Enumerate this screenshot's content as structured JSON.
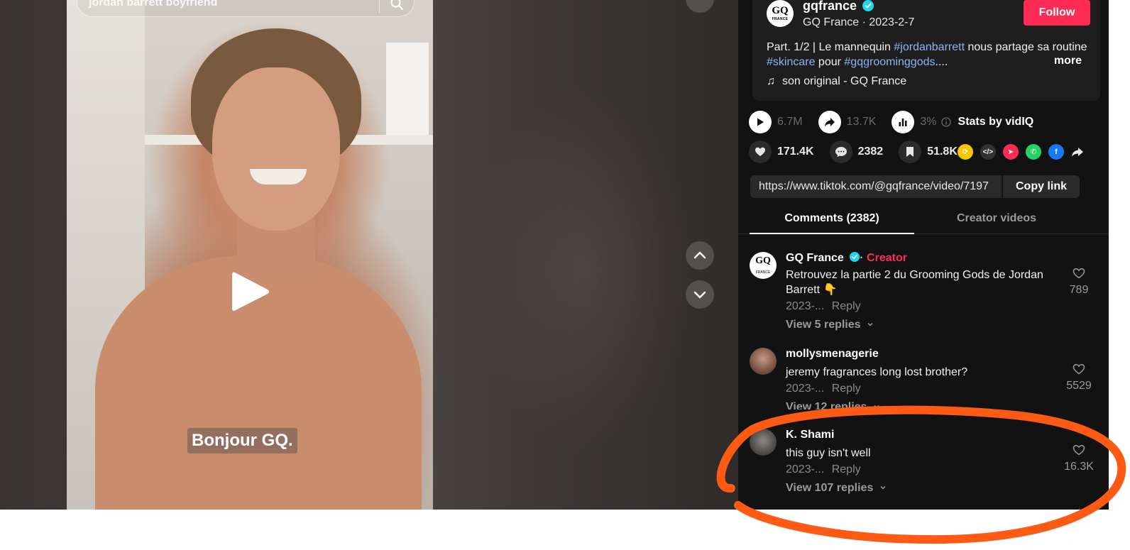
{
  "search": {
    "query": "jordan barrett boyfriend"
  },
  "video": {
    "caption": "Bonjour GQ.",
    "colors": {
      "panel_bg": "#121212",
      "accent": "#fe2c55",
      "hashtag": "#8ab4f8",
      "annotation": "#ff5a14"
    }
  },
  "author": {
    "avatar_text": "GQ",
    "avatar_subtext": "FRANCE",
    "handle": "gqfrance",
    "subline": "GQ France · 2023-2-7",
    "follow_label": "Follow",
    "verified_icon": "verified-badge-icon"
  },
  "description": {
    "part1": "Part. 1/2 | Le mannequin ",
    "tag1": "#jordanbarrett",
    "part2": " nous partage sa routine ",
    "tag2": "#skincare",
    "part3": " pour ",
    "tag3": "#gqgroominggods",
    "part4": "....",
    "more_label": "more",
    "music": "son original - GQ France"
  },
  "stats": {
    "plays": "6.7M",
    "shares": "13.7K",
    "engagement": "3%",
    "vidiq_label": "Stats by vidIQ",
    "likes": "171.4K",
    "comments": "2382",
    "saves": "51.8K"
  },
  "link": {
    "url": "https://www.tiktok.com/@gqfrance/video/7197",
    "copy_label": "Copy link"
  },
  "tabs": {
    "comments": "Comments (2382)",
    "creator_videos": "Creator videos"
  },
  "comments": [
    {
      "name": "GQ France",
      "creator_label": "Creator",
      "text": "Retrouvez la partie 2 du Grooming Gods de Jordan Barrett 👇",
      "date": "2023-...",
      "reply_label": "Reply",
      "replies": "View 5 replies",
      "likes": "789"
    },
    {
      "name": "mollysmenagerie",
      "text": "jeremy fragrances long lost brother?",
      "date": "2023-...",
      "reply_label": "Reply",
      "replies": "View 12 replies",
      "likes": "5529"
    },
    {
      "name": "K. Shami",
      "text": "this guy isn't well",
      "date": "2023-...",
      "reply_label": "Reply",
      "replies": "View 107 replies",
      "likes": "16.3K"
    }
  ]
}
